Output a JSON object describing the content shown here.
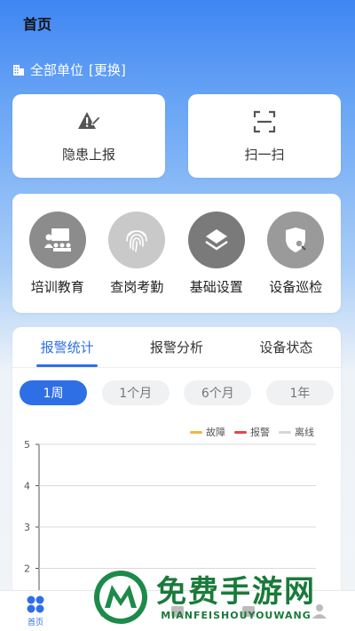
{
  "header": {
    "title": "首页"
  },
  "unit": {
    "label": "全部单位",
    "switch_label": "[更换]"
  },
  "quick_actions": [
    {
      "label": "隐患上报",
      "icon": "hazard-report-icon"
    },
    {
      "label": "扫一扫",
      "icon": "scan-icon"
    }
  ],
  "menu": [
    {
      "label": "培训教育",
      "icon": "training-icon",
      "color": "#8c8c8c"
    },
    {
      "label": "查岗考勤",
      "icon": "fingerprint-icon",
      "color": "#c9c9c9"
    },
    {
      "label": "基础设置",
      "icon": "layers-icon",
      "color": "#7a7a7a"
    },
    {
      "label": "设备巡检",
      "icon": "shield-search-icon",
      "color": "#9a9a9a"
    }
  ],
  "stats": {
    "tabs": [
      "报警统计",
      "报警分析",
      "设备状态"
    ],
    "periods": [
      "1周",
      "1个月",
      "6个月",
      "1年"
    ]
  },
  "chart_data": {
    "type": "line",
    "y_ticks": [
      "5",
      "4",
      "3",
      "2"
    ],
    "legend": [
      {
        "name": "故障",
        "color": "#f5b342"
      },
      {
        "name": "报警",
        "color": "#e84545"
      },
      {
        "name": "离线",
        "color": "#d6d6d6"
      }
    ],
    "grid": true
  },
  "nav": [
    {
      "label": "首页",
      "active": true
    },
    {
      "label": "",
      "active": false
    },
    {
      "label": "",
      "active": false
    },
    {
      "label": "",
      "active": false
    },
    {
      "label": "",
      "active": false
    }
  ],
  "watermark": {
    "title": "免费手游网",
    "subtitle": "MIANFEISHOUYOUWANG"
  }
}
